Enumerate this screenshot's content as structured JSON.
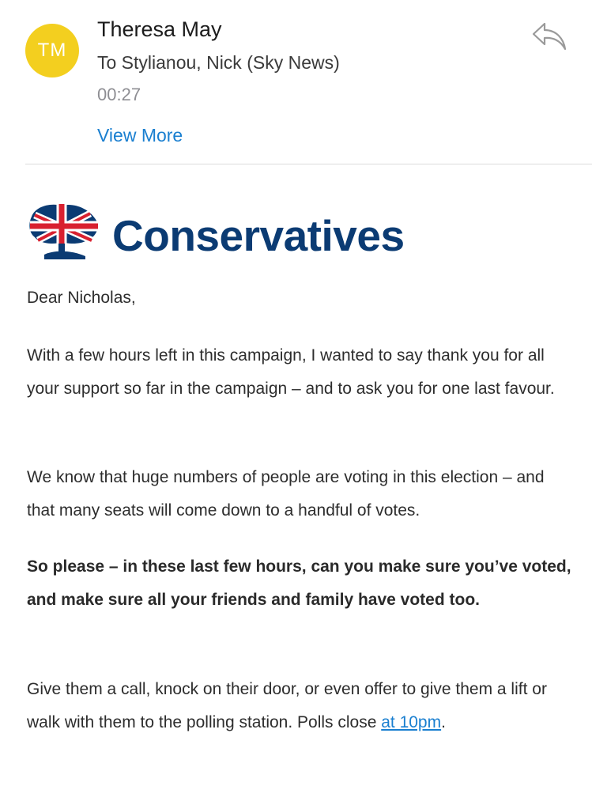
{
  "header": {
    "avatar_initials": "TM",
    "sender_name": "Theresa May",
    "recipient": "To Stylianou, Nick (Sky News)",
    "time": "00:27",
    "view_more": "View More"
  },
  "logo": {
    "wordmark": "Conservatives"
  },
  "email": {
    "greeting": "Dear Nicholas,",
    "p1": "With a few hours left in this campaign, I wanted to say thank you for all your support so far in the campaign – and to ask you for one last favour.",
    "p2": "We know that huge numbers of people are voting in this election – and that many seats will come down to a handful of votes.",
    "p3_bold": "So please – in these last few hours, can you make sure you’ve voted, and make sure all your friends and family have voted too.",
    "p4_text": "Give them a call, knock on their door, or even offer to give them a lift or walk with them to the polling station. Polls close ",
    "p4_link": "at 10pm",
    "p4_end": "."
  },
  "colors": {
    "avatar": "#f3cf1f",
    "link": "#1a7fd0",
    "brand_blue": "#0b3b73",
    "brand_red": "#d8202f"
  },
  "icons": {
    "reply": "reply-arrow-icon"
  }
}
